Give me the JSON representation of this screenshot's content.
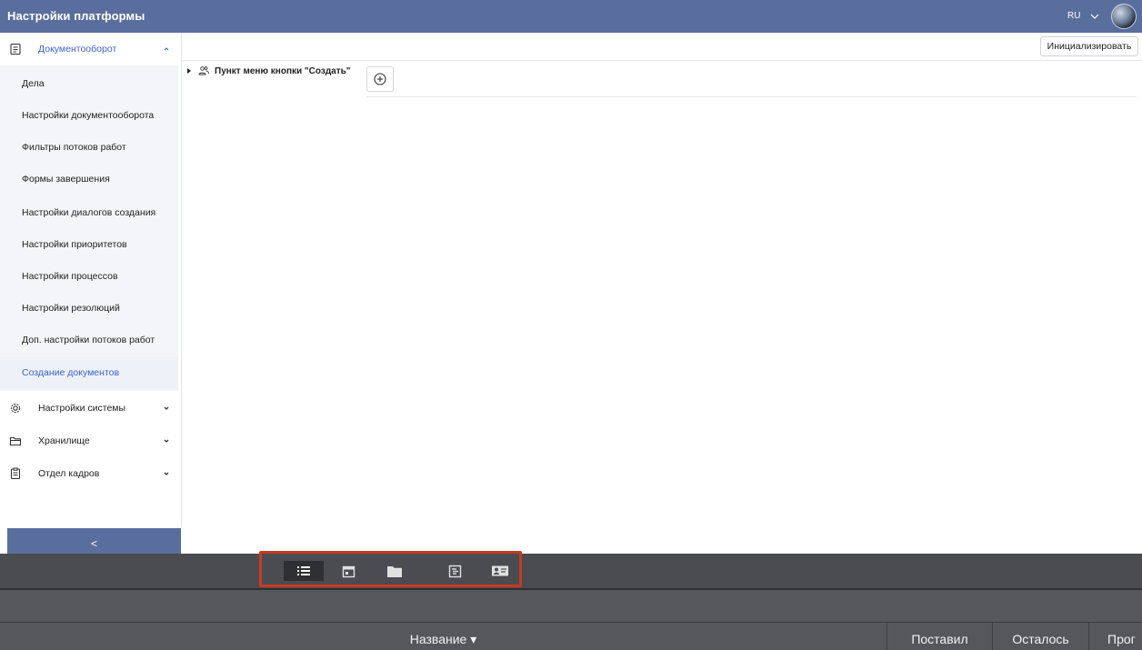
{
  "header": {
    "title": "Настройки платформы",
    "lang": "RU"
  },
  "sidebar": {
    "groups": [
      {
        "label": "Документооборот",
        "icon": "document-icon",
        "expanded": true
      },
      {
        "label": "Настройки системы",
        "icon": "gear-icon",
        "expanded": false
      },
      {
        "label": "Хранилище",
        "icon": "folder-icon",
        "expanded": false
      },
      {
        "label": "Отдел кадров",
        "icon": "clipboard-icon",
        "expanded": false
      }
    ],
    "items": [
      {
        "label": "Дела"
      },
      {
        "label": "Настройки документооборота"
      },
      {
        "label": "Фильтры потоков работ"
      },
      {
        "label": "Формы завершения"
      },
      {
        "label": "Настройки диалогов создания"
      },
      {
        "label": "Настройки приоритетов"
      },
      {
        "label": "Настройки процессов"
      },
      {
        "label": "Настройки резолюций"
      },
      {
        "label": "Доп. настройки потоков работ"
      },
      {
        "label": "Создание документов",
        "selected": true
      }
    ],
    "collapse_label": "<"
  },
  "main": {
    "init_button": "Инициализировать",
    "tree_node": "Пункт меню кнопки \"Создать\""
  },
  "bottom": {
    "toolbar_icons": [
      "list-icon",
      "calendar-icon",
      "folder-icon",
      "board-icon",
      "contact-card-icon"
    ],
    "columns": [
      "Название ▾",
      "Поставил",
      "Осталось",
      "Прог"
    ]
  },
  "colors": {
    "header_bg": "#5a6e9e",
    "accent": "#3d63c9",
    "highlight": "#c8391f",
    "dark_bg": "#4a4c52"
  }
}
